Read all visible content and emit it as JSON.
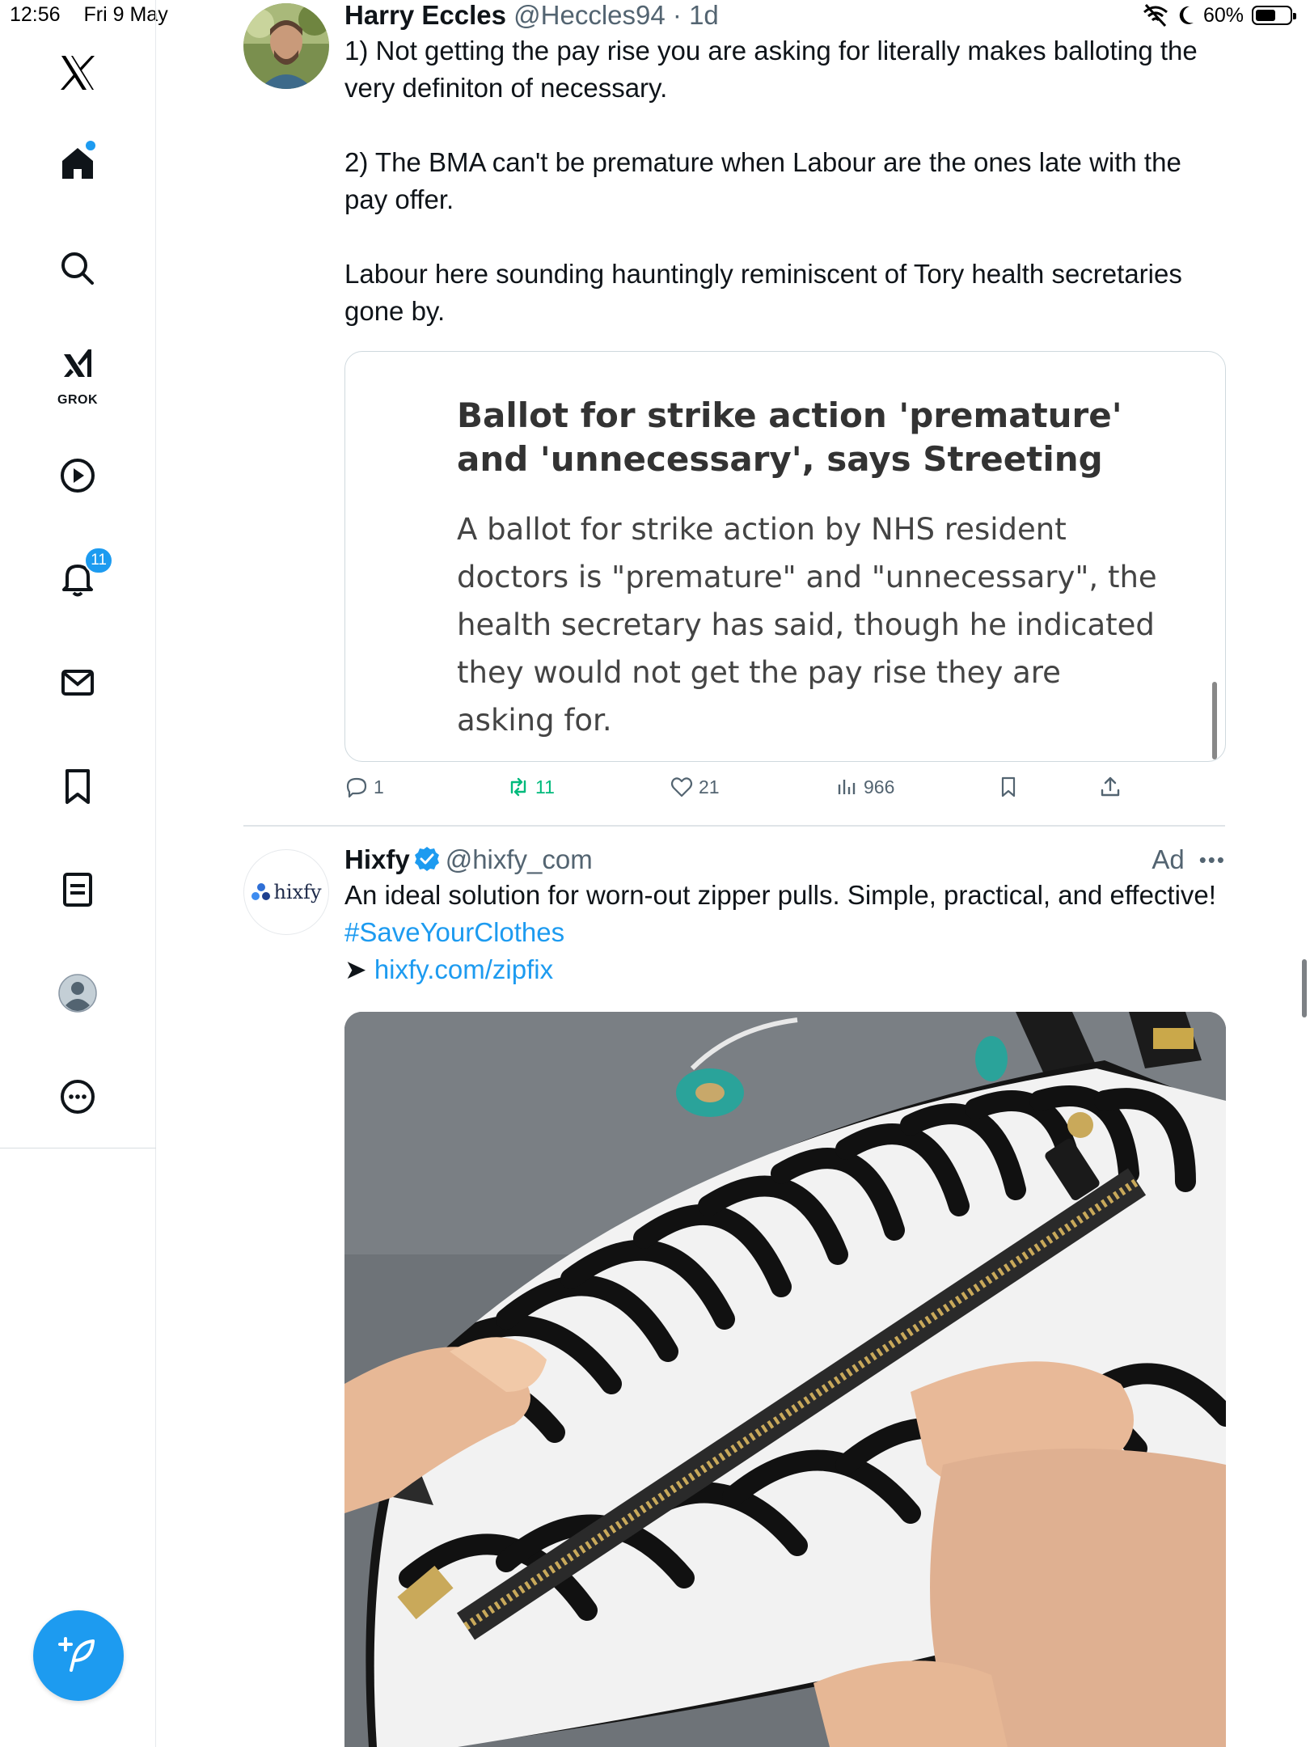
{
  "status_bar": {
    "time": "12:56",
    "date": "Fri 9 May",
    "battery": "60%",
    "battery_level": 0.6
  },
  "sidebar": {
    "logo": "x-logo-icon",
    "items": [
      {
        "name": "home",
        "icon": "home-icon",
        "has_dot": true
      },
      {
        "name": "search",
        "icon": "search-icon"
      },
      {
        "name": "grok",
        "icon": "grok-icon",
        "label": "GROK"
      },
      {
        "name": "video",
        "icon": "play-icon"
      },
      {
        "name": "notifications",
        "icon": "bell-icon",
        "badge": "11"
      },
      {
        "name": "messages",
        "icon": "mail-icon"
      },
      {
        "name": "bookmarks",
        "icon": "bookmark-icon"
      },
      {
        "name": "lists",
        "icon": "list-icon"
      },
      {
        "name": "profile",
        "icon": "avatar-icon"
      },
      {
        "name": "more",
        "icon": "more-icon"
      }
    ],
    "compose": "compose-icon"
  },
  "tweet1": {
    "display_name": "Harry Eccles",
    "handle": "@Heccles94",
    "time": "· 1d",
    "text": "1) Not getting the pay rise you are asking for literally makes balloting the very definiton of necessary.\n\n2) The BMA can't be premature when Labour are the ones late with the pay offer.\n\nLabour here sounding hauntingly reminiscent of Tory health secretaries gone by.",
    "card": {
      "headline": "Ballot for strike action 'premature' and 'unnecessary', says Streeting",
      "summary": "A ballot for strike action by NHS resident doctors is \"premature\" and \"unnecessary\", the health secretary has said, though he indicated they would not get the pay rise they are asking for."
    },
    "stats": {
      "replies": "1",
      "reposts": "11",
      "likes": "21",
      "views": "966"
    }
  },
  "tweet2": {
    "display_name": "Hixfy",
    "handle": "@hixfy_com",
    "ad_label": "Ad",
    "logo_text": "hixfy",
    "text_main": "An ideal solution for worn-out zipper pulls. Simple, practical, and effective! ",
    "hashtag": "#SaveYourClothes",
    "arrow": "➤ ",
    "link": "hixfy.com/zipfix"
  },
  "colors": {
    "accent": "#1d9bf0",
    "repost": "#00ba7c",
    "secondary_text": "#536471"
  }
}
